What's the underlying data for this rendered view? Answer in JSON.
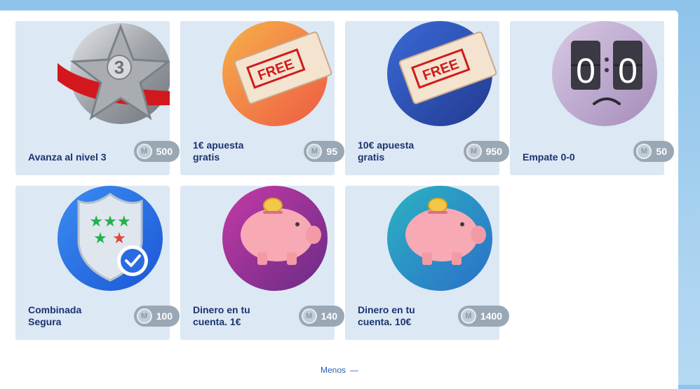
{
  "cards": [
    {
      "label": "Avanza al nivel 3",
      "price": "500",
      "art_icon": "silver-star-level-3-icon"
    },
    {
      "label": "1€ apuesta gratis",
      "price": "95",
      "art_icon": "free-ticket-icon",
      "ticket_text": "FREE",
      "colors": [
        "#f6b14a",
        "#ee5a44"
      ]
    },
    {
      "label": "10€ apuesta gratis",
      "price": "950",
      "art_icon": "free-ticket-icon",
      "ticket_text": "FREE",
      "colors": [
        "#3a6ad8",
        "#233a8f"
      ]
    },
    {
      "label": "Empate 0-0",
      "price": "50",
      "art_icon": "scoreboard-sad-icon",
      "score_left": "0",
      "score_right": "0"
    },
    {
      "label": "Combinada Segura",
      "price": "100",
      "art_icon": "shield-check-icon"
    },
    {
      "label": "Dinero en tu cuenta. 1€",
      "price": "140",
      "art_icon": "piggy-bank-icon",
      "colors": [
        "#c43aa6",
        "#6a2b86"
      ]
    },
    {
      "label": "Dinero en tu cuenta. 10€",
      "price": "1400",
      "art_icon": "piggy-bank-icon",
      "colors": [
        "#2bb3c2",
        "#2b6fc8"
      ]
    }
  ],
  "coin_letter": "M",
  "toggle": {
    "label": "Menos",
    "icon": "minus-icon",
    "symbol": "—"
  }
}
